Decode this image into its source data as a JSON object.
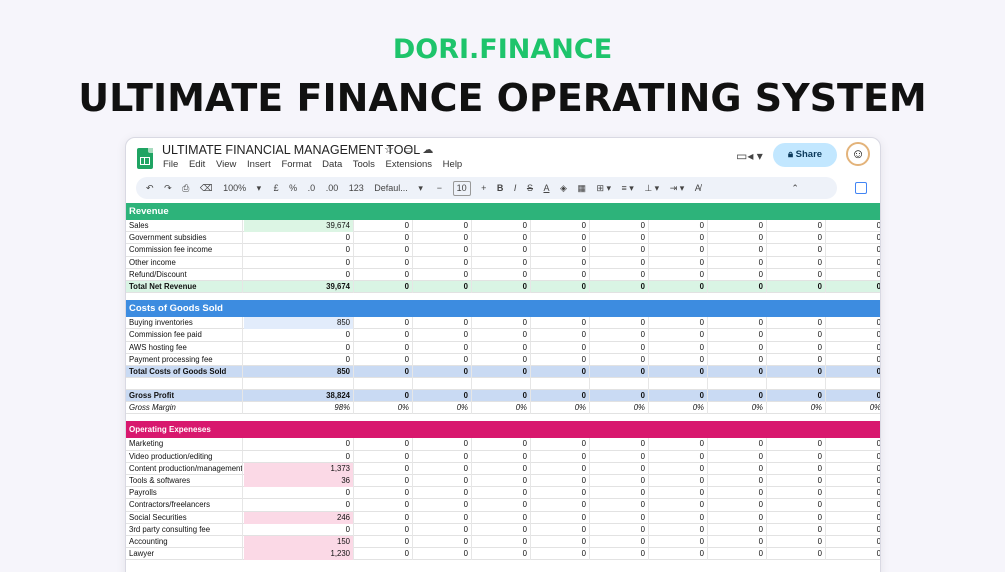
{
  "brand": "DORI.FINANCE",
  "headline": "ULTIMATE FINANCE OPERATING SYSTEM",
  "app": {
    "doc_title": "ULTIMATE FINANCIAL MANAGEMENT TOOL",
    "title_icons": [
      "star-icon",
      "folder-icon",
      "cloud-icon"
    ],
    "menu": [
      "File",
      "Edit",
      "View",
      "Insert",
      "Format",
      "Data",
      "Tools",
      "Extensions",
      "Help"
    ],
    "share_label": "Share",
    "toolbar": {
      "zoom": "100%",
      "currency": "£",
      "percent": "%",
      "dec_less": ".0",
      "dec_more": ".00",
      "number_format": "123",
      "font": "Defaul...",
      "font_size": "10"
    }
  },
  "sheet": {
    "revenue": {
      "header": "Revenue",
      "rows": [
        {
          "label": "Sales",
          "first": "39,674"
        },
        {
          "label": "Government subsidies",
          "first": "0"
        },
        {
          "label": "Commission fee income",
          "first": "0"
        },
        {
          "label": "Other income",
          "first": "0"
        },
        {
          "label": "Refund/Discount",
          "first": "0"
        }
      ],
      "total": {
        "label": "Total Net Revenue",
        "first": "39,674"
      }
    },
    "cogs": {
      "header": "Costs of Goods Sold",
      "rows": [
        {
          "label": "Buying inventories",
          "first": "850"
        },
        {
          "label": "Commission fee paid",
          "first": "0"
        },
        {
          "label": "AWS hosting fee",
          "first": "0"
        },
        {
          "label": "Payment processing fee",
          "first": "0"
        }
      ],
      "total": {
        "label": "Total Costs of Goods Sold",
        "first": "850"
      }
    },
    "gross_profit": {
      "label": "Gross Profit",
      "first": "38,824"
    },
    "gross_margin": {
      "label": "Gross Margin",
      "first": "98%",
      "rest": "0%"
    },
    "opex": {
      "header": "Operating Expeneses",
      "rows": [
        {
          "label": "Marketing",
          "first": "0"
        },
        {
          "label": "Video production/editing",
          "first": "0"
        },
        {
          "label": "Content production/management",
          "first": "1,373"
        },
        {
          "label": "Tools & softwares",
          "first": "36"
        },
        {
          "label": "Payrolls",
          "first": "0"
        },
        {
          "label": "Contractors/freelancers",
          "first": "0"
        },
        {
          "label": "Social Securities",
          "first": "246"
        },
        {
          "label": "3rd party consulting fee",
          "first": "0"
        },
        {
          "label": "Accounting",
          "first": "150"
        },
        {
          "label": "Lawyer",
          "first": "1,230"
        }
      ]
    },
    "zero": "0"
  }
}
